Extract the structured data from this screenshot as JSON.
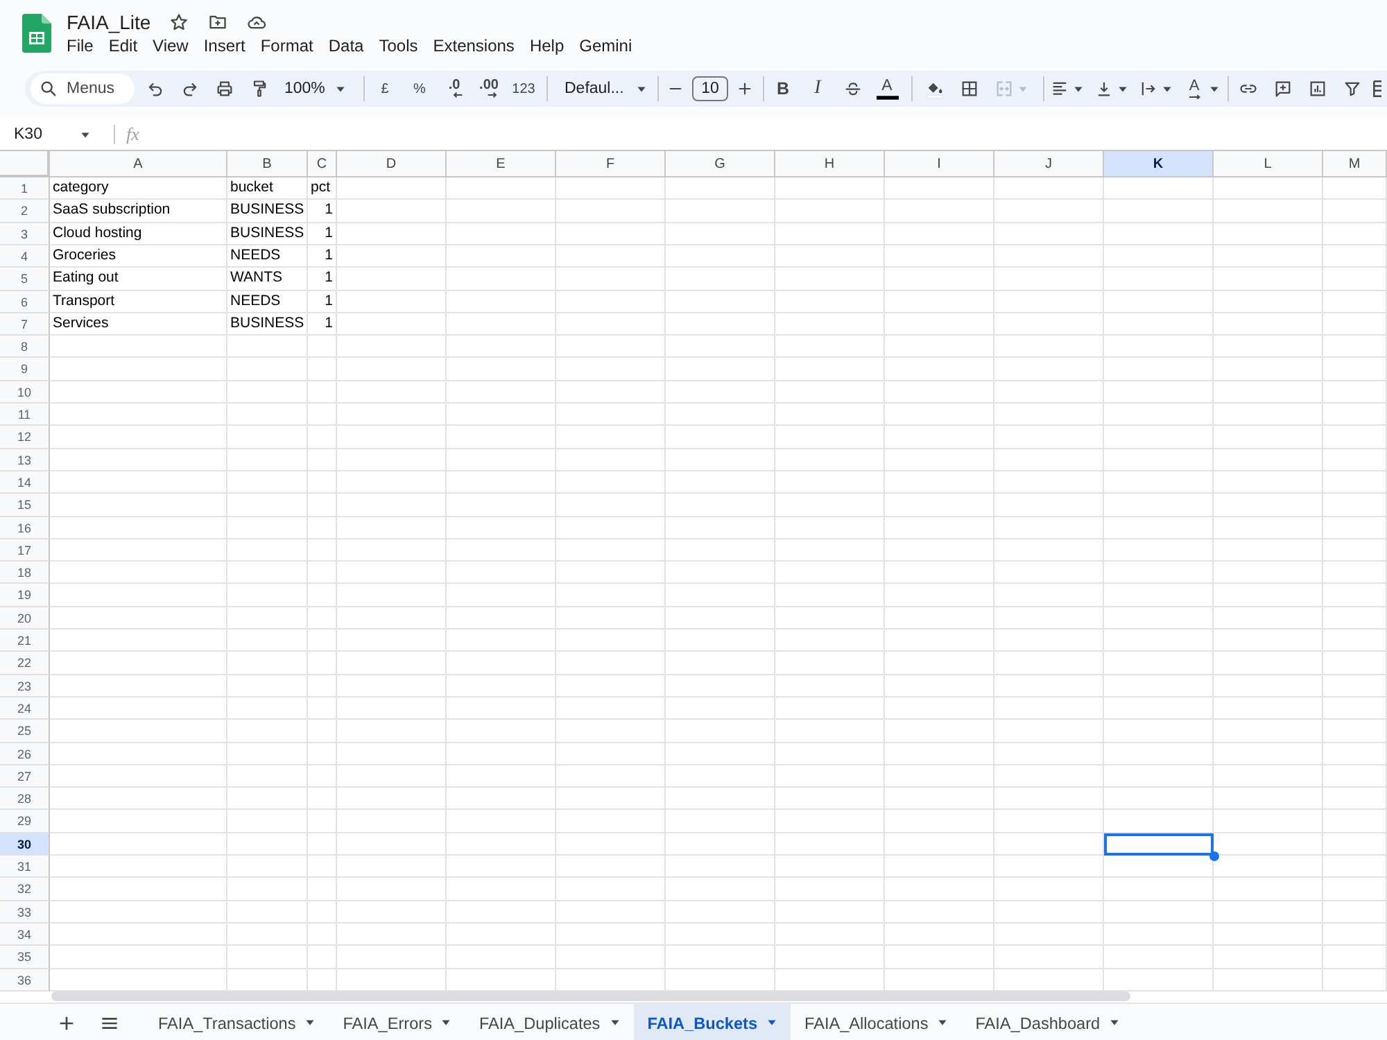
{
  "document": {
    "title": "FAIA_Lite"
  },
  "menu": [
    "File",
    "Edit",
    "View",
    "Insert",
    "Format",
    "Data",
    "Tools",
    "Extensions",
    "Help",
    "Gemini"
  ],
  "toolbar": {
    "search": {
      "placeholder": "Menus"
    },
    "zoom": "100%",
    "number_formats": [
      {
        "kind": "plain",
        "label": "£"
      },
      {
        "kind": "plain",
        "label": "%"
      },
      {
        "kind": "decrease",
        "label": ".0"
      },
      {
        "kind": "increase",
        "label": ".00"
      },
      {
        "kind": "plain",
        "label": "123"
      }
    ],
    "font": "Defaul...",
    "font_size": "10",
    "text_styles": [
      {
        "kind": "bold",
        "label": "B"
      },
      {
        "kind": "italic",
        "label": "I"
      }
    ],
    "text_color_label": "A",
    "merge": {
      "disabled": true
    },
    "rotation_label": "A"
  },
  "name_box": "K30",
  "formula_bar": {
    "label": "fx"
  },
  "grid": {
    "columns": [
      {
        "label": "A",
        "selected": false
      },
      {
        "label": "B",
        "selected": false
      },
      {
        "label": "C",
        "selected": false
      },
      {
        "label": "D",
        "selected": false
      },
      {
        "label": "E",
        "selected": false
      },
      {
        "label": "F",
        "selected": false
      },
      {
        "label": "G",
        "selected": false
      },
      {
        "label": "H",
        "selected": false
      },
      {
        "label": "I",
        "selected": false
      },
      {
        "label": "J",
        "selected": false
      },
      {
        "label": "K",
        "selected": true
      },
      {
        "label": "L",
        "selected": false
      },
      {
        "label": "M",
        "selected": false
      }
    ],
    "rows": [
      {
        "number": "1",
        "selected": false,
        "cells": [
          {
            "kind": "text",
            "value": "category"
          },
          {
            "kind": "text",
            "value": "bucket"
          },
          {
            "kind": "text",
            "value": "pct"
          }
        ]
      },
      {
        "number": "2",
        "selected": false,
        "cells": [
          {
            "kind": "text",
            "value": "SaaS subscription"
          },
          {
            "kind": "text",
            "value": "BUSINESS"
          },
          {
            "kind": "number",
            "value": "1"
          }
        ]
      },
      {
        "number": "3",
        "selected": false,
        "cells": [
          {
            "kind": "text",
            "value": "Cloud hosting"
          },
          {
            "kind": "text",
            "value": "BUSINESS"
          },
          {
            "kind": "number",
            "value": "1"
          }
        ]
      },
      {
        "number": "4",
        "selected": false,
        "cells": [
          {
            "kind": "text",
            "value": "Groceries"
          },
          {
            "kind": "text",
            "value": "NEEDS"
          },
          {
            "kind": "number",
            "value": "1"
          }
        ]
      },
      {
        "number": "5",
        "selected": false,
        "cells": [
          {
            "kind": "text",
            "value": "Eating out"
          },
          {
            "kind": "text",
            "value": "WANTS"
          },
          {
            "kind": "number",
            "value": "1"
          }
        ]
      },
      {
        "number": "6",
        "selected": false,
        "cells": [
          {
            "kind": "text",
            "value": "Transport"
          },
          {
            "kind": "text",
            "value": "NEEDS"
          },
          {
            "kind": "number",
            "value": "1"
          }
        ]
      },
      {
        "number": "7",
        "selected": false,
        "cells": [
          {
            "kind": "text",
            "value": "Services"
          },
          {
            "kind": "text",
            "value": "BUSINESS"
          },
          {
            "kind": "number",
            "value": "1"
          }
        ]
      },
      {
        "number": "8",
        "selected": false
      },
      {
        "number": "9",
        "selected": false
      },
      {
        "number": "10",
        "selected": false
      },
      {
        "number": "11",
        "selected": false
      },
      {
        "number": "12",
        "selected": false
      },
      {
        "number": "13",
        "selected": false
      },
      {
        "number": "14",
        "selected": false
      },
      {
        "number": "15",
        "selected": false
      },
      {
        "number": "16",
        "selected": false
      },
      {
        "number": "17",
        "selected": false
      },
      {
        "number": "18",
        "selected": false
      },
      {
        "number": "19",
        "selected": false
      },
      {
        "number": "20",
        "selected": false
      },
      {
        "number": "21",
        "selected": false
      },
      {
        "number": "22",
        "selected": false
      },
      {
        "number": "23",
        "selected": false
      },
      {
        "number": "24",
        "selected": false
      },
      {
        "number": "25",
        "selected": false
      },
      {
        "number": "26",
        "selected": false
      },
      {
        "number": "27",
        "selected": false
      },
      {
        "number": "28",
        "selected": false
      },
      {
        "number": "29",
        "selected": false
      },
      {
        "number": "30",
        "selected": true
      },
      {
        "number": "31",
        "selected": false
      },
      {
        "number": "32",
        "selected": false
      },
      {
        "number": "33",
        "selected": false
      },
      {
        "number": "34",
        "selected": false
      },
      {
        "number": "35",
        "selected": false
      },
      {
        "number": "36",
        "selected": false
      }
    ]
  },
  "sheet_tabs": [
    {
      "label": "FAIA_Transactions",
      "selected": false
    },
    {
      "label": "FAIA_Errors",
      "selected": false
    },
    {
      "label": "FAIA_Duplicates",
      "selected": false
    },
    {
      "label": "FAIA_Buckets",
      "selected": true
    },
    {
      "label": "FAIA_Allocations",
      "selected": false
    },
    {
      "label": "FAIA_Dashboard",
      "selected": false
    }
  ]
}
